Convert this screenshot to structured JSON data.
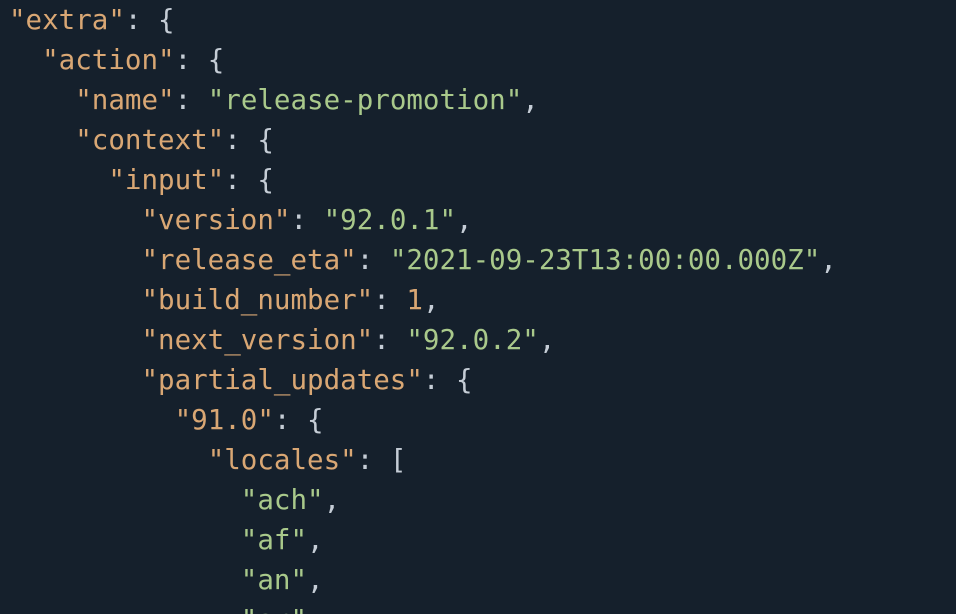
{
  "theme": {
    "background": "#15202c",
    "key_color": "#d9a774",
    "string_color": "#a9c98b",
    "number_color": "#d9a774",
    "punctuation_color": "#c5cdd6"
  },
  "lines": [
    {
      "indent": "",
      "tokens": [
        {
          "t": "key",
          "v": "\"extra\""
        },
        {
          "t": "punct",
          "v": ": {"
        }
      ]
    },
    {
      "indent": "  ",
      "tokens": [
        {
          "t": "key",
          "v": "\"action\""
        },
        {
          "t": "punct",
          "v": ": {"
        }
      ]
    },
    {
      "indent": "    ",
      "tokens": [
        {
          "t": "key",
          "v": "\"name\""
        },
        {
          "t": "punct",
          "v": ": "
        },
        {
          "t": "str",
          "v": "\"release-promotion\""
        },
        {
          "t": "punct",
          "v": ","
        }
      ]
    },
    {
      "indent": "    ",
      "tokens": [
        {
          "t": "key",
          "v": "\"context\""
        },
        {
          "t": "punct",
          "v": ": {"
        }
      ]
    },
    {
      "indent": "      ",
      "tokens": [
        {
          "t": "key",
          "v": "\"input\""
        },
        {
          "t": "punct",
          "v": ": {"
        }
      ]
    },
    {
      "indent": "        ",
      "tokens": [
        {
          "t": "key",
          "v": "\"version\""
        },
        {
          "t": "punct",
          "v": ": "
        },
        {
          "t": "str",
          "v": "\"92.0.1\""
        },
        {
          "t": "punct",
          "v": ","
        }
      ]
    },
    {
      "indent": "        ",
      "tokens": [
        {
          "t": "key",
          "v": "\"release_eta\""
        },
        {
          "t": "punct",
          "v": ": "
        },
        {
          "t": "str",
          "v": "\"2021-09-23T13:00:00.000Z\""
        },
        {
          "t": "punct",
          "v": ","
        }
      ]
    },
    {
      "indent": "        ",
      "tokens": [
        {
          "t": "key",
          "v": "\"build_number\""
        },
        {
          "t": "punct",
          "v": ": "
        },
        {
          "t": "num",
          "v": "1"
        },
        {
          "t": "punct",
          "v": ","
        }
      ]
    },
    {
      "indent": "        ",
      "tokens": [
        {
          "t": "key",
          "v": "\"next_version\""
        },
        {
          "t": "punct",
          "v": ": "
        },
        {
          "t": "str",
          "v": "\"92.0.2\""
        },
        {
          "t": "punct",
          "v": ","
        }
      ]
    },
    {
      "indent": "        ",
      "tokens": [
        {
          "t": "key",
          "v": "\"partial_updates\""
        },
        {
          "t": "punct",
          "v": ": {"
        }
      ]
    },
    {
      "indent": "          ",
      "tokens": [
        {
          "t": "key",
          "v": "\"91.0\""
        },
        {
          "t": "punct",
          "v": ": {"
        }
      ]
    },
    {
      "indent": "            ",
      "tokens": [
        {
          "t": "key",
          "v": "\"locales\""
        },
        {
          "t": "punct",
          "v": ": ["
        }
      ]
    },
    {
      "indent": "              ",
      "tokens": [
        {
          "t": "str",
          "v": "\"ach\""
        },
        {
          "t": "punct",
          "v": ","
        }
      ]
    },
    {
      "indent": "              ",
      "tokens": [
        {
          "t": "str",
          "v": "\"af\""
        },
        {
          "t": "punct",
          "v": ","
        }
      ]
    },
    {
      "indent": "              ",
      "tokens": [
        {
          "t": "str",
          "v": "\"an\""
        },
        {
          "t": "punct",
          "v": ","
        }
      ]
    },
    {
      "indent": "              ",
      "tokens": [
        {
          "t": "str",
          "v": "\"ar\""
        },
        {
          "t": "punct",
          "v": ","
        }
      ]
    }
  ]
}
